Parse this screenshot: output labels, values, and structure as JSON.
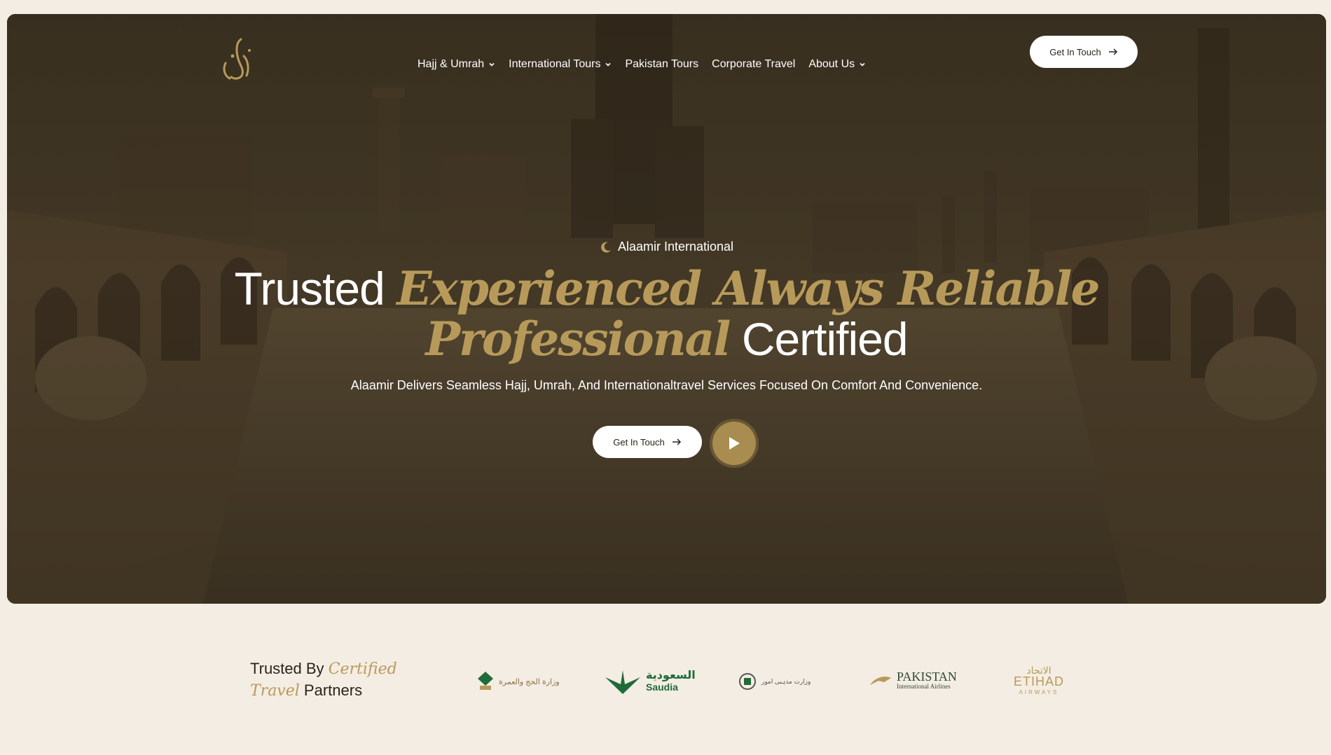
{
  "nav": {
    "items": [
      {
        "label": "Hajj & Umrah",
        "dropdown": true
      },
      {
        "label": "International Tours",
        "dropdown": true
      },
      {
        "label": "Pakistan Tours",
        "dropdown": false
      },
      {
        "label": "Corporate Travel",
        "dropdown": false
      },
      {
        "label": "About Us",
        "dropdown": true
      }
    ],
    "cta_label": "Get In Touch"
  },
  "hero": {
    "eyebrow": "Alaamir International",
    "headline": {
      "word1": "Trusted",
      "gold1": "Experienced Always Reliable",
      "gold2": "Professional",
      "word2": "Certified"
    },
    "subtitle": "Alaamir Delivers Seamless Hajj, Umrah, And Internationaltravel Services Focused On Comfort And Convenience.",
    "cta_label": "Get In Touch"
  },
  "partners": {
    "title_part1": "Trusted By",
    "title_gold1": "Certified",
    "title_gold2": "Travel",
    "title_part2": "Partners",
    "logos": [
      {
        "icon": "ministry-hajj-umrah-logo",
        "text": "وزارة الحج والعمرة"
      },
      {
        "icon": "saudia-logo",
        "text": "السعودية",
        "subtext": "Saudia"
      },
      {
        "icon": "pakistan-ministry-logo",
        "text": "وزارت مذہبی امور"
      },
      {
        "icon": "pia-logo",
        "text": "PAKISTAN",
        "subtext": "International Airlines"
      },
      {
        "icon": "etihad-logo",
        "text": "الاتحاد",
        "subtext": "ETIHAD"
      }
    ]
  },
  "colors": {
    "gold": "#b79a5a",
    "background": "#f4ede3",
    "saudia_green": "#1f6b3a"
  }
}
